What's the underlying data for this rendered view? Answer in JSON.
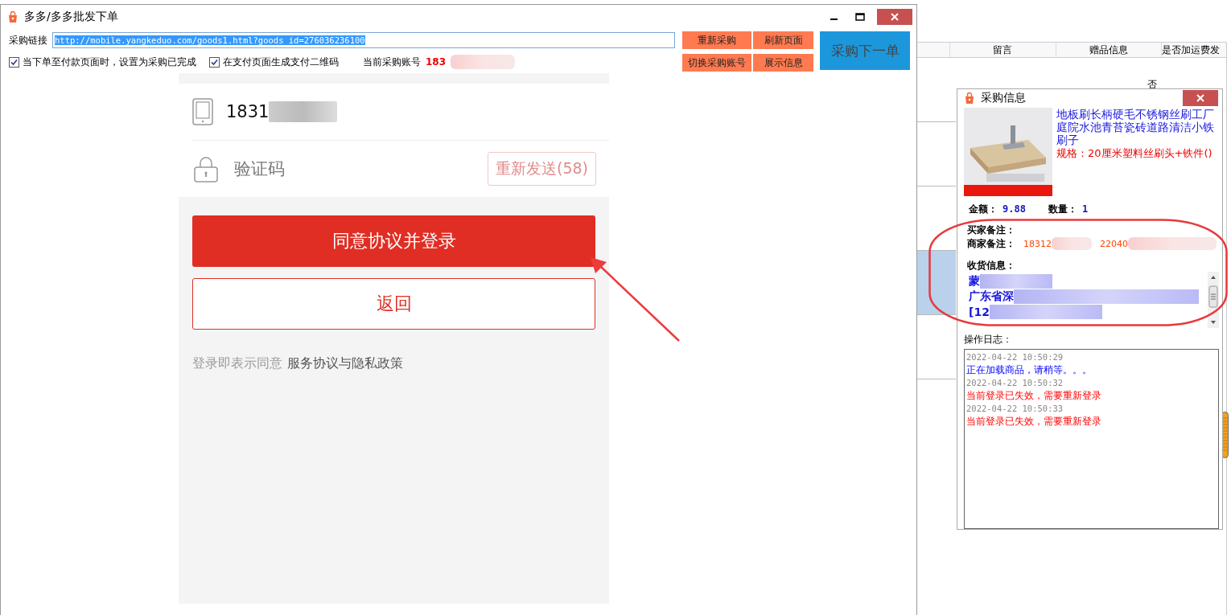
{
  "background_table": {
    "columns": [
      "留言",
      "赠品信息",
      "是否加运费发"
    ],
    "rows": [
      {
        "cell": "否",
        "selected": false
      },
      {
        "cell": "",
        "selected": false
      },
      {
        "cell": "",
        "selected": false
      },
      {
        "cell": "",
        "selected": true
      },
      {
        "cell": "",
        "selected": false
      }
    ]
  },
  "main_window": {
    "title": "多多/多多批发下单",
    "url_label": "采购链接",
    "url": "http://mobile.yangkeduo.com/goods1.html?goods_id=276036236100",
    "options": [
      {
        "label": "当下单至付款页面时，设置为采购已完成",
        "checked": true
      },
      {
        "label": "在支付页面生成支付二维码",
        "checked": true
      }
    ],
    "account_label": "当前采购账号",
    "account": "183",
    "buttons": [
      "重新采购",
      "刷新页面",
      "切换采购账号",
      "展示信息"
    ],
    "next_button": "采购下一单"
  },
  "login_page": {
    "phone": "1831",
    "code_placeholder": "验证码",
    "resend": "重新发送(58)",
    "resend_disabled": true,
    "login_button": "同意协议并登录",
    "back_button": "返回",
    "agreement_text": "登录即表示同意",
    "agreement_link": "服务协议与隐私政策"
  },
  "purchase_info": {
    "title": "采购信息",
    "product_title": "地板刷长柄硬毛不锈钢丝刷工厂庭院水池青苔瓷砖道路清洁小铁刷子",
    "spec": "规格：20厘米塑料丝刷头+铁件()",
    "amount_label": "金额：",
    "amount": "9.88",
    "qty_label": "数量：",
    "qty": "1",
    "buyer_note_label": "买家备注：",
    "seller_note_label": "商家备注：",
    "seller_note": [
      "18312",
      "22040"
    ],
    "shipping_label": "收货信息：",
    "address_lines": [
      "蒙",
      "广东省深",
      "[12"
    ],
    "log_label": "操作日志：",
    "log": [
      {
        "kind": "time",
        "text": "2022-04-22 10:50:29"
      },
      {
        "kind": "info",
        "text": "正在加载商品，请稍等。。。"
      },
      {
        "kind": "time",
        "text": "2022-04-22 10:50:32"
      },
      {
        "kind": "error",
        "text": "当前登录已失效，需要重新登录"
      },
      {
        "kind": "time",
        "text": "2022-04-22 10:50:33"
      },
      {
        "kind": "error",
        "text": "当前登录已失效，需要重新登录"
      }
    ]
  }
}
